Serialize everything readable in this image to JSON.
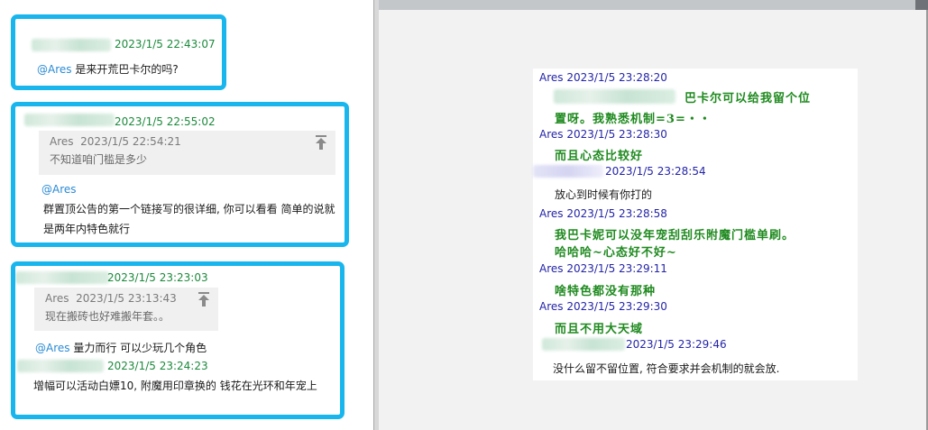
{
  "left_chat": {
    "card1": {
      "time": "2023/1/5 22:43:07",
      "mention": "@Ares",
      "message": " 是来开荒巴卡尔的吗?"
    },
    "card2": {
      "time": "2023/1/5 22:55:02",
      "quote_sender": "Ares",
      "quote_time": "2023/1/5 22:54:21",
      "quote_text": "不知道咱门槛是多少",
      "mention": "@Ares",
      "message": "群置顶公告的第一个链接写的很详细, 你可以看看 简单的说就是两年内特色就行"
    },
    "card3": {
      "time": "2023/1/5 23:23:03",
      "quote_sender": "Ares",
      "quote_time": "2023/1/5 23:13:43",
      "quote_text": "现在搬砖也好难搬年套。。",
      "mention": "@Ares",
      "message": " 量力而行 可以少玩几个角色",
      "time2": "2023/1/5 23:24:23",
      "message2": "增幅可以活动白嫖10, 附魔用印章换的 钱花在光环和年宠上"
    }
  },
  "right_log": {
    "entries": [
      {
        "meta": "Ares 2023/1/5 23:28:20"
      },
      {
        "text": "巴卡尔可以给我留个位"
      },
      {
        "text": "置呀。我熟悉机制=3=・・"
      },
      {
        "meta": "Ares 2023/1/5 23:28:30"
      },
      {
        "text": "而且心态比较好"
      },
      {
        "meta": "2023/1/5 23:28:54"
      },
      {
        "text": "放心到时候有你打的"
      },
      {
        "meta": "Ares 2023/1/5 23:28:58"
      },
      {
        "text": "我巴卡妮可以没年宠刮刮乐附魔门槛单刷。"
      },
      {
        "text": "哈哈哈~心态好不好~"
      },
      {
        "meta": "Ares 2023/1/5 23:29:11"
      },
      {
        "text": "啥特色都没有那种"
      },
      {
        "meta": "Ares 2023/1/5 23:29:30"
      },
      {
        "text": "而且不用大天域"
      },
      {
        "meta": "2023/1/5 23:29:46"
      },
      {
        "text": "没什么留不留位置, 符合要求并会机制的就会放."
      }
    ]
  },
  "icons": {
    "pin": "pin-to-top-icon"
  },
  "colors": {
    "card_border": "#19b6ee",
    "left_timestamp": "#1b8a3c",
    "mention": "#2a8bd4",
    "log_header": "#2424a8",
    "log_handwriting": "#1f8a1f"
  }
}
